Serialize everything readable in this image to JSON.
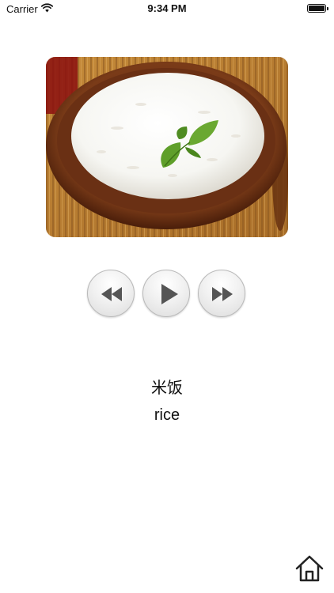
{
  "status_bar": {
    "carrier": "Carrier",
    "time": "9:34 PM",
    "icons": [
      "wifi-icon",
      "battery-icon"
    ]
  },
  "image": {
    "subject": "bowl-of-rice-with-basil-leaves"
  },
  "controls": {
    "icons": [
      "rewind-icon",
      "play-icon",
      "fast-forward-icon"
    ]
  },
  "word": {
    "chinese": "米饭",
    "english": "rice"
  },
  "navigation": {
    "icons": [
      "home-icon"
    ]
  }
}
